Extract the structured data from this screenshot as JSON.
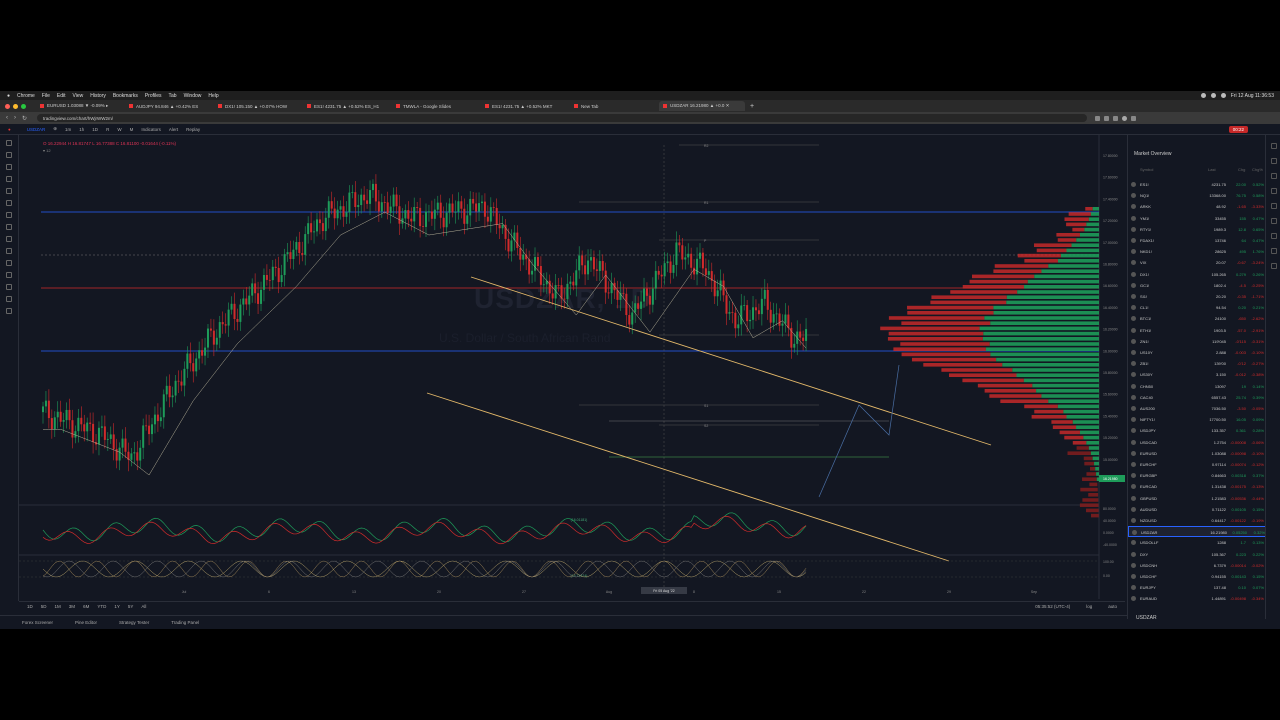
{
  "os_menu": {
    "items": [
      "Chrome",
      "File",
      "Edit",
      "View",
      "History",
      "Bookmarks",
      "Profiles",
      "Tab",
      "Window",
      "Help"
    ],
    "clock": "Fri 12 Aug 11:36:53"
  },
  "browser": {
    "tabs": [
      {
        "label": "EURUSD 1.03088 ▼ -0.09% ▸"
      },
      {
        "label": "AUDJPY 94.846 ▲ +0.42% ES"
      },
      {
        "label": "DX1! 105.150 ▲ +0.07% HOW"
      },
      {
        "label": "ES1! 4231.75 ▲ +0.52% ES_H1"
      },
      {
        "label": "TMWLA - Google Slides"
      },
      {
        "label": "ES1! 4231.75 ▲ +0.52% MKT"
      },
      {
        "label": "New Tab"
      },
      {
        "label": "USDZAR 16.21980 ▲ +0.0 ✕"
      }
    ],
    "url": "tradingview.com/chart/hWjrWW2m/"
  },
  "tv_toolbar": {
    "symbol": "USDZAR",
    "intervals": [
      "1m",
      "1h",
      "1D",
      "R",
      "W",
      "M"
    ],
    "indicators": "Indicators",
    "alert": "Alert",
    "replay": "Replay",
    "record": "00:22"
  },
  "chart": {
    "legend": "O 16.22944 H 16.81747 L 16.77388 C 16.81100 -0.01644 (-0.11%)",
    "legend_sub": "▾ 12",
    "watermark_symbol": "USDZAR, 1D",
    "watermark_desc": "U.S. Dollar / South African Rand",
    "price_labels": [
      "17.80000",
      "17.60000",
      "17.40000",
      "17.20000",
      "17.00000",
      "16.80000",
      "16.60000",
      "16.40000",
      "16.20000",
      "16.00000",
      "15.80000",
      "15.60000",
      "15.40000",
      "15.20000",
      "15.00000"
    ],
    "current_price": "16.21980",
    "level_labels": [
      "R2",
      "R1",
      "P",
      "S1",
      "S2"
    ],
    "sub_labels": [
      "(16.01181)",
      "(15.71424)"
    ],
    "time_labels": [
      "Jul",
      "6",
      "13",
      "20",
      "27",
      "Aug",
      "8",
      "15",
      "22",
      "29",
      "Sep"
    ],
    "cursor_date": "Fri 05 Aug '22",
    "osc1_labels": [
      "80.0000",
      "40.0000",
      "0.0000",
      "-40.0000"
    ],
    "osc2_labels": [
      "100.00",
      "0.00"
    ],
    "colors": {
      "up": "#1e9c5a",
      "down": "#d12b2b",
      "trend": "#e4b96a",
      "hline": "#2962ff",
      "red": "#d12b2b"
    }
  },
  "range_bar": {
    "ranges": [
      "1D",
      "5D",
      "1M",
      "3M",
      "6M",
      "YTD",
      "1Y",
      "5Y",
      "All"
    ],
    "timezone": "05:35:52 (UTC-4)",
    "log": "log",
    "auto": "auto"
  },
  "bottom_panel": {
    "tabs": [
      "Forex Screener",
      "Pine Editor",
      "Strategy Tester",
      "Trading Panel"
    ]
  },
  "watchlist": {
    "title": "Market Overview",
    "headers": {
      "symbol": "Symbol",
      "last": "Last",
      "chg": "Chg",
      "chgp": "Chg%"
    },
    "rows": [
      {
        "s": "ES1!",
        "l": "4231.75",
        "c": "22.00",
        "p": "0.52%",
        "up": true
      },
      {
        "s": "NQ1!",
        "l": "13368.00",
        "c": "76.75",
        "p": "0.58%",
        "up": true
      },
      {
        "s": "ARKK",
        "l": "48.92",
        "c": "-1.65",
        "p": "-3.33%",
        "up": false
      },
      {
        "s": "YM1!",
        "l": "33455",
        "c": "155",
        "p": "0.47%",
        "up": true
      },
      {
        "s": "RTY1!",
        "l": "1989.3",
        "c": "12.8",
        "p": "0.65%",
        "up": true
      },
      {
        "s": "FDAX1!",
        "l": "13746",
        "c": "64",
        "p": "0.47%",
        "up": true
      },
      {
        "s": "NKD1!",
        "l": "28625",
        "c": "495",
        "p": "1.76%",
        "up": true
      },
      {
        "s": "VIX",
        "l": "20.07",
        "c": "-0.67",
        "p": "-3.24%",
        "up": false
      },
      {
        "s": "DX1!",
        "l": "105.265",
        "c": "0.279",
        "p": "0.26%",
        "up": true
      },
      {
        "s": "GC1!",
        "l": "1802.4",
        "c": "-4.5",
        "p": "-0.25%",
        "up": false
      },
      {
        "s": "SI1!",
        "l": "20.20",
        "c": "-0.35",
        "p": "-1.71%",
        "up": false
      },
      {
        "s": "CL1!",
        "l": "94.54",
        "c": "0.20",
        "p": "0.21%",
        "up": true
      },
      {
        "s": "BTC1!",
        "l": "24100",
        "c": "-650",
        "p": "-2.62%",
        "up": false
      },
      {
        "s": "ETH1!",
        "l": "1903.5",
        "c": "-57.0",
        "p": "-2.91%",
        "up": false
      },
      {
        "s": "ZN1!",
        "l": "119'045",
        "c": "-0'115",
        "p": "-0.31%",
        "up": false
      },
      {
        "s": "US10Y",
        "l": "2.888",
        "c": "-0.003",
        "p": "-0.10%",
        "up": false
      },
      {
        "s": "ZB1!",
        "l": "139'00",
        "c": "-0'12",
        "p": "-0.27%",
        "up": false
      },
      {
        "s": "US30Y",
        "l": "3.150",
        "c": "-0.012",
        "p": "-0.38%",
        "up": false
      },
      {
        "s": "CHN50",
        "l": "13097",
        "c": "19",
        "p": "0.14%",
        "up": true
      },
      {
        "s": "CAC40",
        "l": "6557.43",
        "c": "25.74",
        "p": "0.39%",
        "up": true
      },
      {
        "s": "AUS200",
        "l": "7036.50",
        "c": "-3.50",
        "p": "-0.05%",
        "up": false
      },
      {
        "s": "NIFTY1!",
        "l": "17700.50",
        "c": "16.05",
        "p": "0.09%",
        "up": true
      },
      {
        "s": "USDJPY",
        "l": "133.357",
        "c": "0.361",
        "p": "0.28%",
        "up": true
      },
      {
        "s": "USDCAD",
        "l": "1.2754",
        "c": "-0.00008",
        "p": "-0.06%",
        "up": false
      },
      {
        "s": "EURUSD",
        "l": "1.03088",
        "c": "-0.00098",
        "p": "-0.10%",
        "up": false
      },
      {
        "s": "EURCHF",
        "l": "0.97114",
        "c": "-0.00074",
        "p": "-0.12%",
        "up": false
      },
      {
        "s": "EURGBP",
        "l": "0.84663",
        "c": "0.00318",
        "p": "0.37%",
        "up": true
      },
      {
        "s": "EURCAD",
        "l": "1.31438",
        "c": "-0.00175",
        "p": "-0.13%",
        "up": false
      },
      {
        "s": "GBPUSD",
        "l": "1.21583",
        "c": "-0.00536",
        "p": "-0.44%",
        "up": false
      },
      {
        "s": "AUDUSD",
        "l": "0.71122",
        "c": "0.00105",
        "p": "0.15%",
        "up": true
      },
      {
        "s": "NZDUSD",
        "l": "0.64417",
        "c": "-0.00122",
        "p": "-0.19%",
        "up": false
      },
      {
        "s": "USDZAR",
        "l": "16.21980",
        "c": "0.05250",
        "p": "0.32%",
        "up": true,
        "sel": true
      },
      {
        "s": "USDOLLF",
        "l": "1288",
        "c": "1.7",
        "p": "0.13%",
        "up": true
      },
      {
        "s": "DXY",
        "l": "105.367",
        "c": "0.223",
        "p": "0.22%",
        "up": true
      },
      {
        "s": "USDCNH",
        "l": "6.7379",
        "c": "-0.00014",
        "p": "-0.02%",
        "up": false
      },
      {
        "s": "USDCHF",
        "l": "0.94155",
        "c": "0.00143",
        "p": "0.15%",
        "up": true
      },
      {
        "s": "EURJPY",
        "l": "137.48",
        "c": "0.10",
        "p": "0.07%",
        "up": true
      },
      {
        "s": "EURAUD",
        "l": "1.44891",
        "c": "-0.00498",
        "p": "-0.34%",
        "up": false
      }
    ],
    "footer": "USDZAR"
  }
}
